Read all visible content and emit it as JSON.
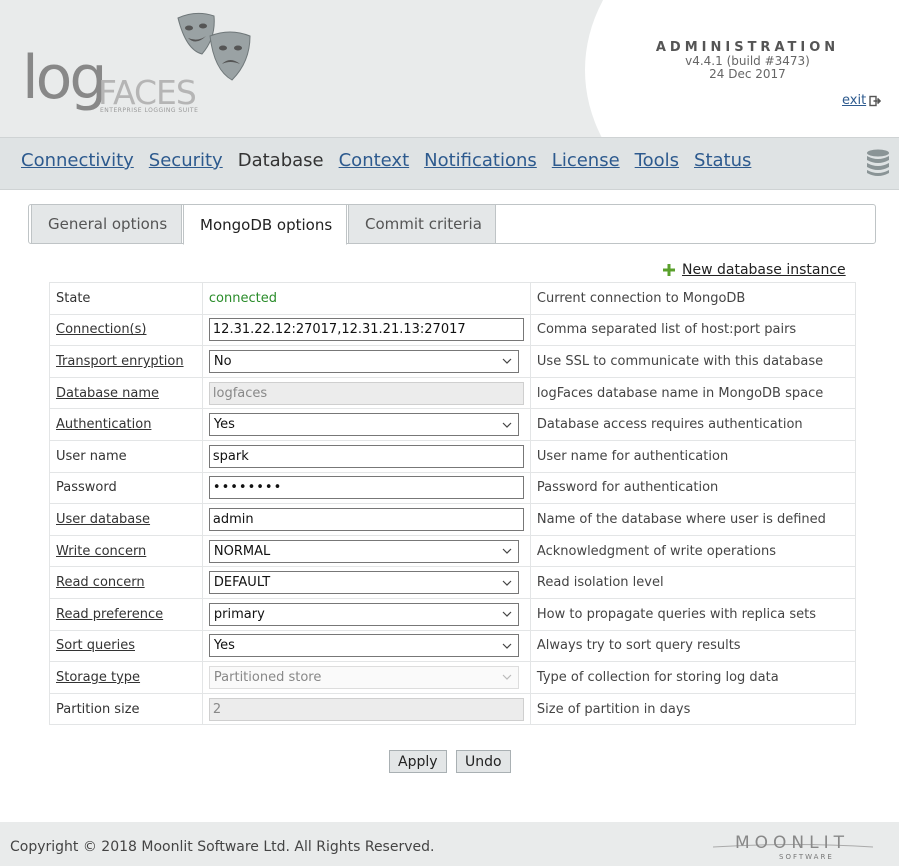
{
  "header": {
    "logo_main": "log",
    "logo_sub": "FACES",
    "logo_tagline": "ENTERPRISE LOGGING SUITE",
    "admin_title": "ADMINISTRATION",
    "version": "v4.4.1 (build #3473)",
    "date": "24 Dec 2017",
    "exit_label": "exit"
  },
  "nav": {
    "items": [
      {
        "label": "Connectivity"
      },
      {
        "label": "Security"
      },
      {
        "label": "Database"
      },
      {
        "label": "Context"
      },
      {
        "label": "Notifications"
      },
      {
        "label": "License"
      },
      {
        "label": "Tools"
      },
      {
        "label": "Status"
      }
    ],
    "active": "Database"
  },
  "tabs": [
    {
      "label": "General options"
    },
    {
      "label": "MongoDB options"
    },
    {
      "label": "Commit criteria"
    }
  ],
  "new_instance_label": "New database instance",
  "rows": [
    {
      "label": "State",
      "value": "connected",
      "desc": "Current connection to MongoDB"
    },
    {
      "label": "Connection(s)",
      "value": "12.31.22.12:27017,12.31.21.13:27017",
      "desc": "Comma separated list of host:port pairs"
    },
    {
      "label": "Transport enryption",
      "value": "No",
      "desc": "Use SSL to communicate with this database"
    },
    {
      "label": "Database name",
      "value": "logfaces",
      "desc": "logFaces database name in MongoDB space"
    },
    {
      "label": "Authentication",
      "value": "Yes",
      "desc": "Database access requires authentication"
    },
    {
      "label": "User name",
      "value": "spark",
      "desc": "User name for authentication"
    },
    {
      "label": "Password",
      "value": "••••••••",
      "desc": "Password for authentication"
    },
    {
      "label": "User database",
      "value": "admin",
      "desc": "Name of the database where user is defined"
    },
    {
      "label": "Write concern",
      "value": "NORMAL",
      "desc": "Acknowledgment of write operations"
    },
    {
      "label": "Read concern",
      "value": "DEFAULT",
      "desc": "Read isolation level"
    },
    {
      "label": "Read preference",
      "value": "primary",
      "desc": "How to propagate queries with replica sets"
    },
    {
      "label": "Sort queries",
      "value": "Yes",
      "desc": "Always try to sort query results"
    },
    {
      "label": "Storage type",
      "value": "Partitioned store",
      "desc": "Type of collection for storing log data"
    },
    {
      "label": "Partition size",
      "value": "2",
      "desc": "Size of partition in days"
    }
  ],
  "buttons": {
    "apply": "Apply",
    "undo": "Undo"
  },
  "footer": {
    "copyright": "Copyright © 2018 Moonlit Software Ltd. All Rights Reserved.",
    "brand": "MOONLIT",
    "brand_sub": "SOFTWARE"
  },
  "colors": {
    "link": "#2d5a8e",
    "connected": "#2a8c2a",
    "header_bg": "#e9ebeb",
    "nav_bg": "#dfe3e4"
  },
  "icons": {
    "masks": "theater-masks-icon",
    "exit": "exit-icon",
    "database": "database-icon",
    "add": "plus-icon",
    "dropdown": "chevron-down-icon"
  }
}
